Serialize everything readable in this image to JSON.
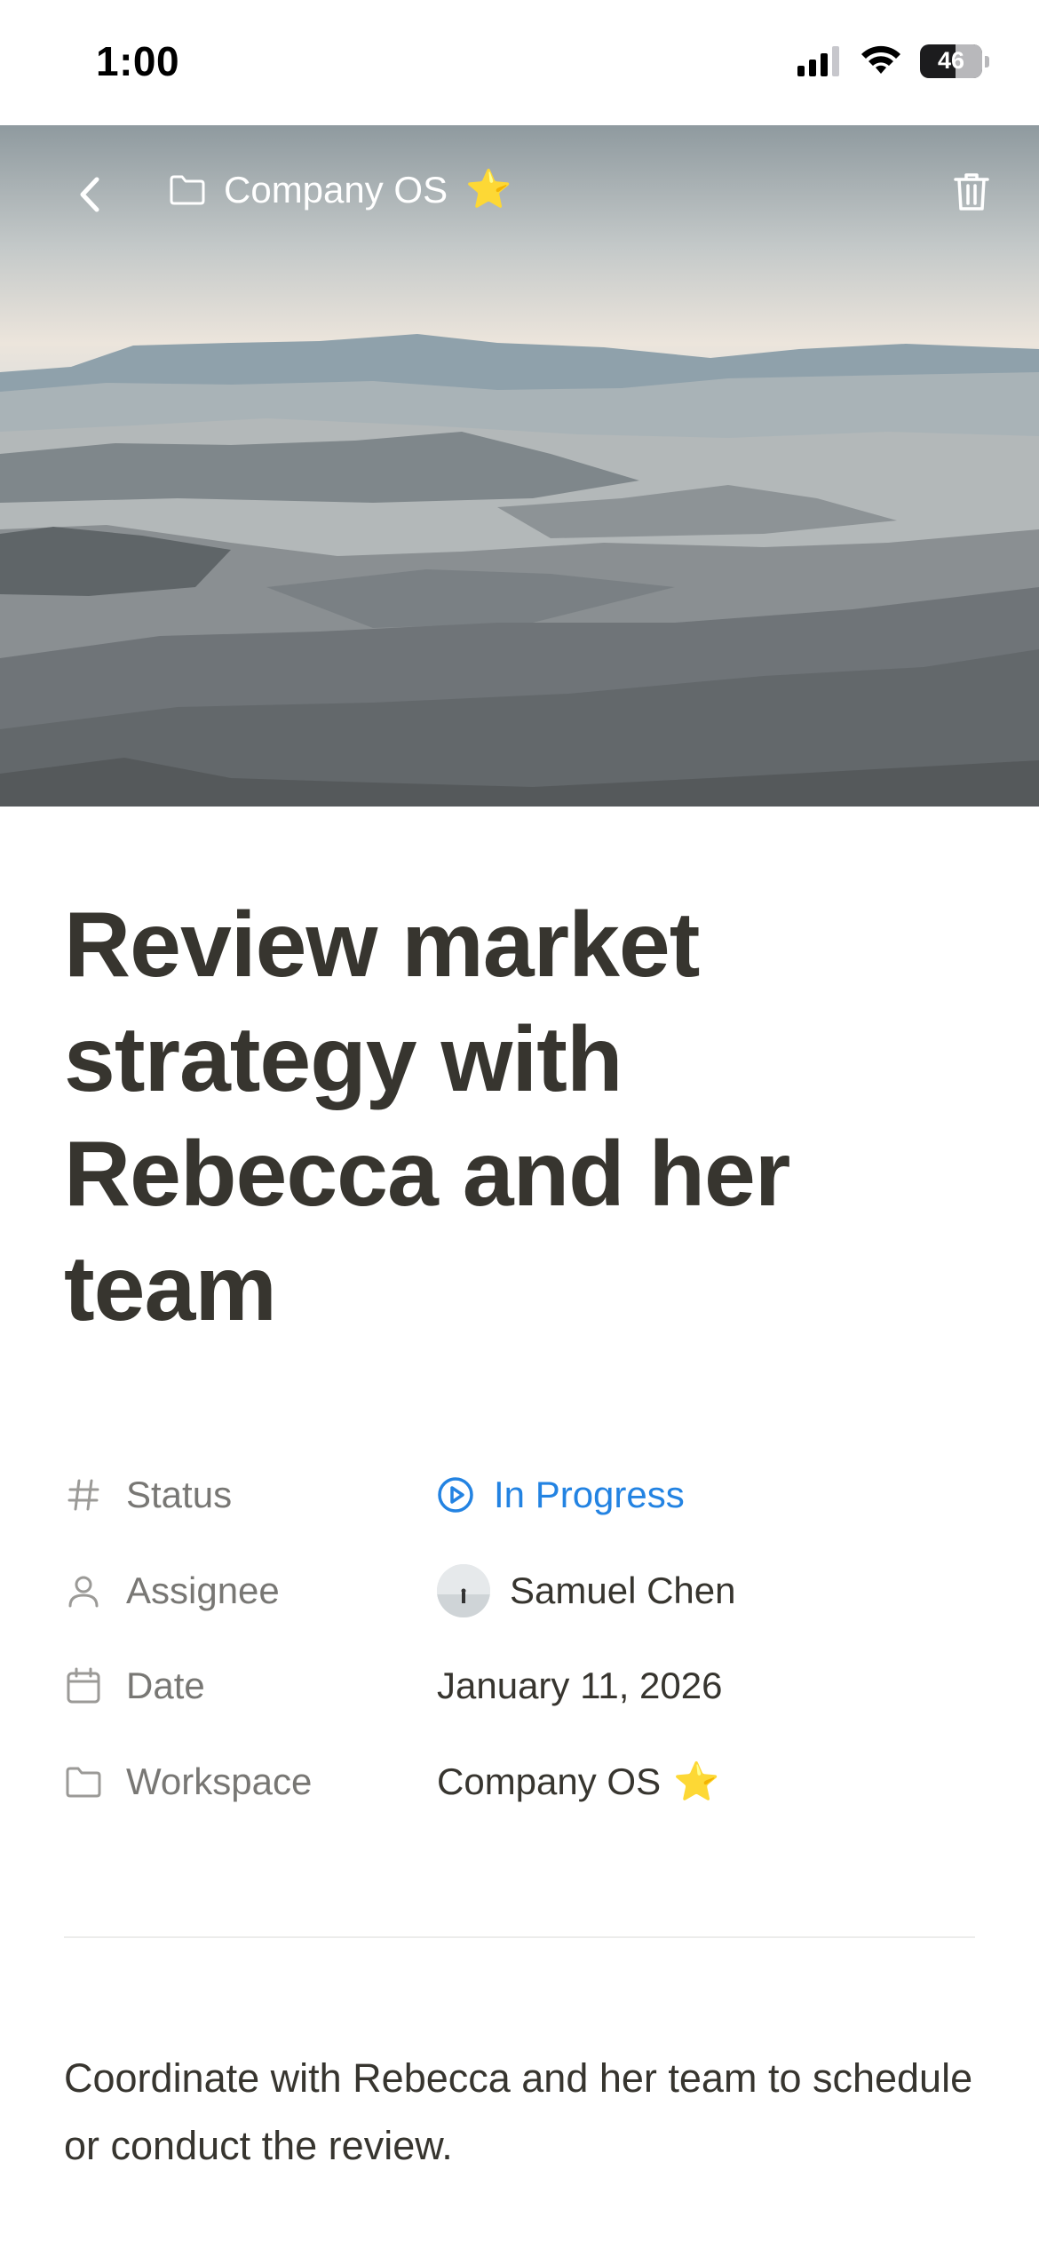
{
  "status_bar": {
    "time": "1:00",
    "battery": "46"
  },
  "nav": {
    "breadcrumb": "Company OS",
    "breadcrumb_emoji": "⭐"
  },
  "page": {
    "title": "Review market strategy with Rebecca and her team"
  },
  "properties": {
    "status": {
      "label": "Status",
      "value": "In Progress",
      "color": "#2383e2"
    },
    "assignee": {
      "label": "Assignee",
      "value": "Samuel Chen"
    },
    "date": {
      "label": "Date",
      "value": "January 11, 2026"
    },
    "workspace": {
      "label": "Workspace",
      "value": "Company OS",
      "emoji": "⭐"
    }
  },
  "body": {
    "text": "Coordinate with Rebecca and her team to schedule or conduct the review."
  }
}
